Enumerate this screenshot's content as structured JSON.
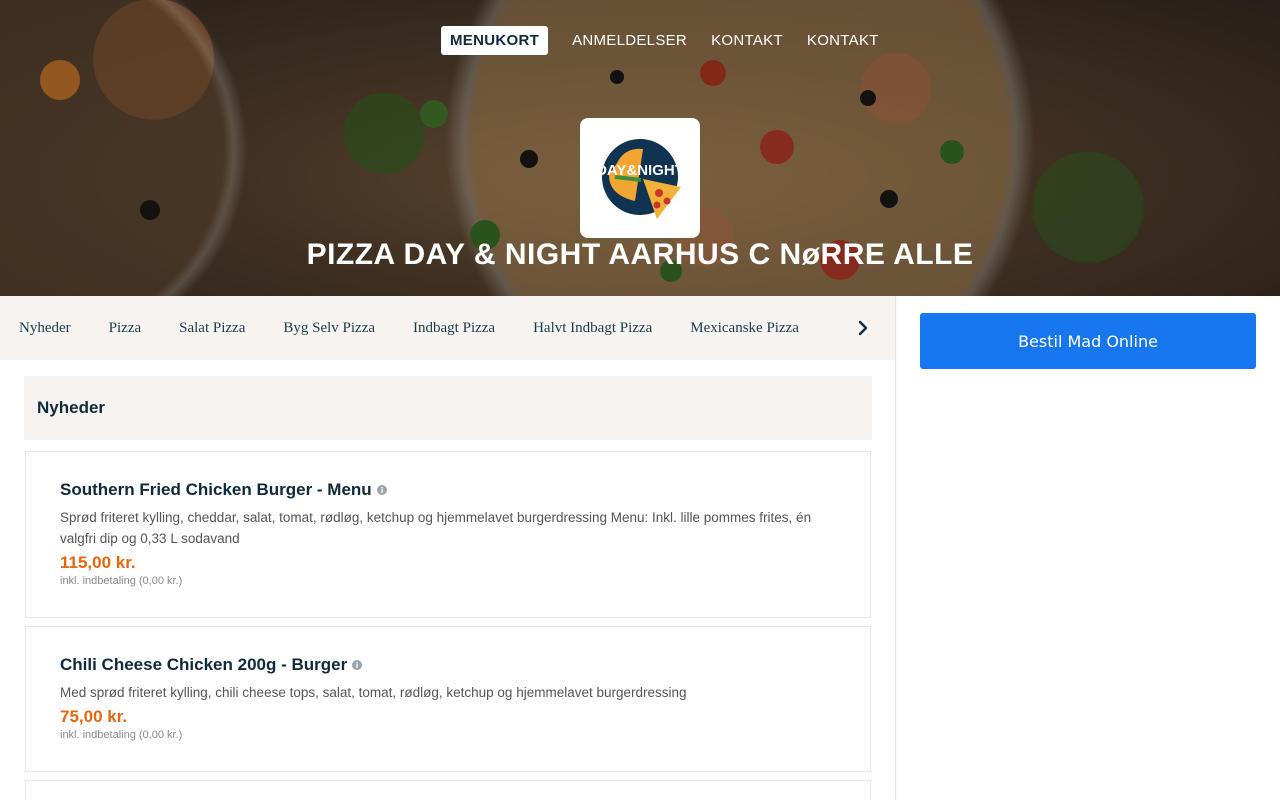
{
  "nav": {
    "items": [
      "MENUKORT",
      "ANMELDELSER",
      "KONTAKT",
      "KONTAKT"
    ]
  },
  "restaurant": {
    "name": "PIZZA DAY & NIGHT AARHUS C NøRRE ALLE",
    "logo_text": "DAY&NIGHT"
  },
  "categories": [
    "Nyheder",
    "Pizza",
    "Salat Pizza",
    "Byg Selv Pizza",
    "Indbagt Pizza",
    "Halvt Indbagt Pizza",
    "Mexicanske Pizza"
  ],
  "order_button": "Bestil Mad Online",
  "section": {
    "title": "Nyheder"
  },
  "items": [
    {
      "name": "Southern Fried Chicken Burger - Menu",
      "description": "Sprød friteret kylling, cheddar, salat, tomat, rødløg, ketchup og hjemmelavet burgerdressing Menu: Inkl. lille pommes frites, én valgfri dip og 0,33 L sodavand",
      "price": "115,00 kr.",
      "deposit": "inkl. indbetaling (0,00 kr.)"
    },
    {
      "name": "Chili Cheese Chicken 200g - Burger",
      "description": "Med sprød friteret kylling, chili cheese tops, salat, tomat, rødløg, ketchup og hjemmelavet burgerdressing",
      "price": "75,00 kr.",
      "deposit": "inkl. indbetaling (0,00 kr.)"
    }
  ],
  "colors": {
    "accent_blue": "#1677ee",
    "price_orange": "#e8650f",
    "title_navy": "#0f2a3a",
    "section_bg": "#f7f3f0"
  },
  "icons": [
    "chevron-right-icon",
    "info-icon",
    "logo-icon"
  ]
}
